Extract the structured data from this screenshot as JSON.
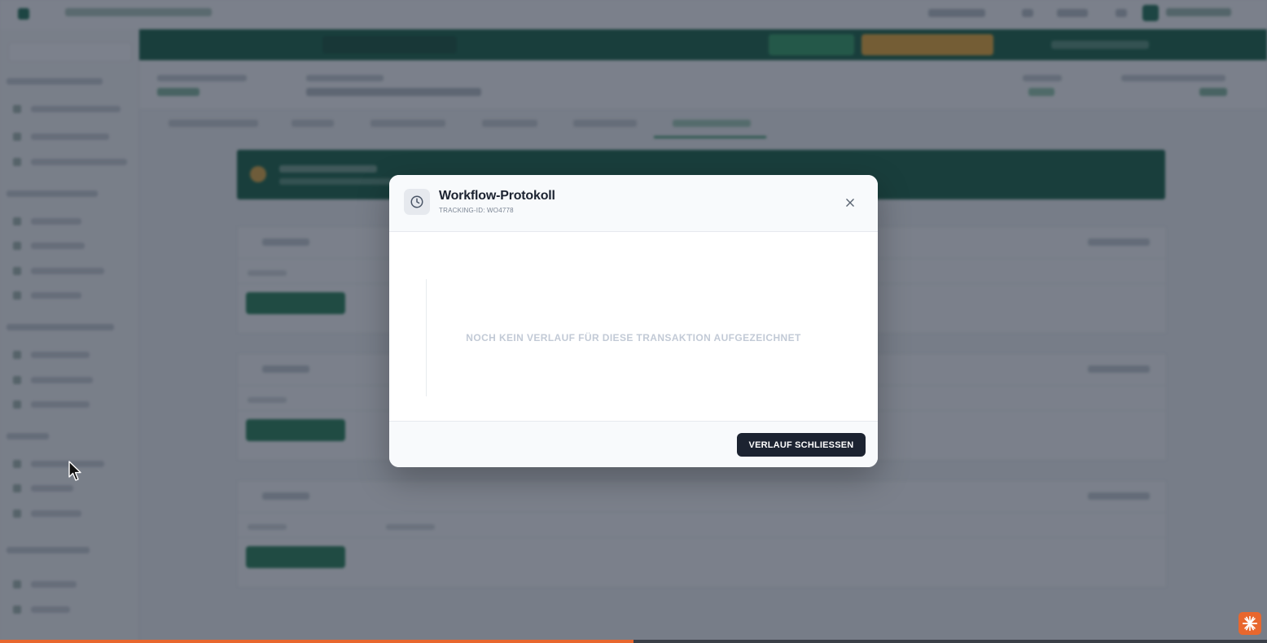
{
  "modal": {
    "title": "Workflow-Protokoll",
    "tracking_id": "TRACKING-ID: WO4778",
    "empty_message": "NOCH KEIN VERLAUF FÜR DIESE TRANSAKTION AUFGEZEICHNET",
    "close_button_label": "VERLAUF SCHLIESSEN",
    "header_icon": "clock-icon",
    "close_icon": "close-icon"
  },
  "progress": {
    "fraction": 0.5
  },
  "colors": {
    "brand_green": "#0f5c3f",
    "accent_orange": "#e8672e",
    "warning_amber": "#e7a52f",
    "primary_dark": "#1c2331",
    "overlay": "#20293a"
  },
  "icons": {
    "corner_button": "asterisk-icon",
    "pointer": "mouse-cursor-icon"
  }
}
